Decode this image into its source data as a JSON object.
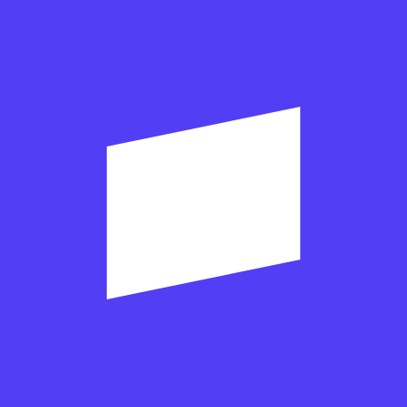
{
  "colors": {
    "background": "#523EF5",
    "mark": "#FFFFFF"
  },
  "icon": {
    "name": "parallelogram-logo-icon"
  }
}
